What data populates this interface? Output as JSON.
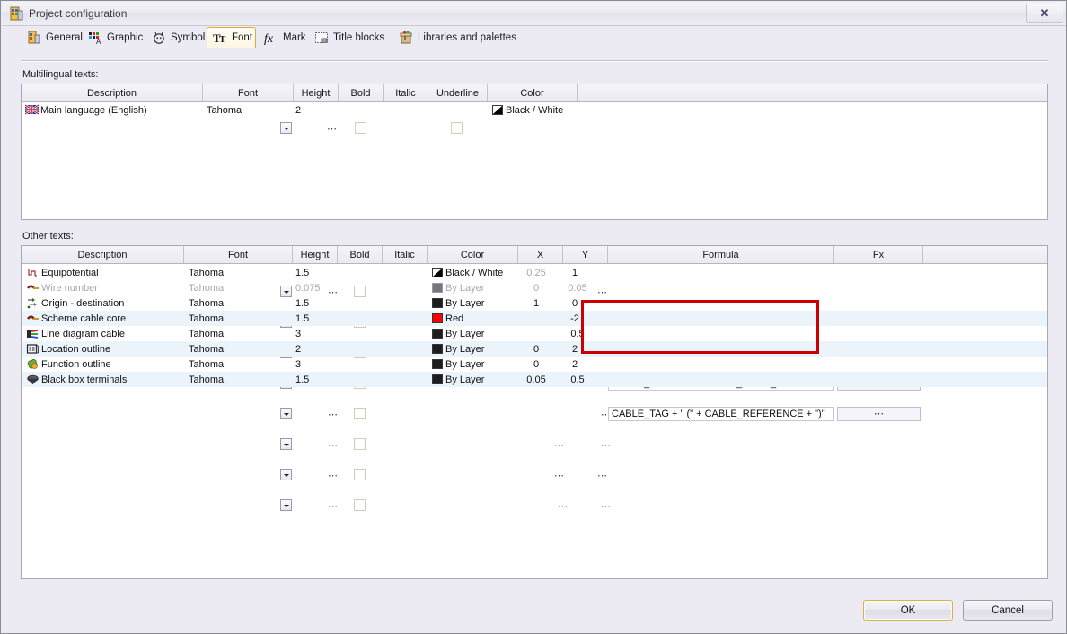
{
  "window": {
    "title": "Project configuration",
    "icon": "project-config-icon",
    "close_label": "✕"
  },
  "tabs": [
    {
      "label": "General",
      "icon": "general-icon",
      "selected": false
    },
    {
      "label": "Graphic",
      "icon": "graphic-icon",
      "selected": false
    },
    {
      "label": "Symbol",
      "icon": "symbol-icon",
      "selected": false
    },
    {
      "label": "Font",
      "icon": "font-icon",
      "selected": true
    },
    {
      "label": "Mark",
      "icon": "fx-icon",
      "selected": false
    },
    {
      "label": "Title blocks",
      "icon": "titleblock-icon",
      "selected": false
    },
    {
      "label": "Libraries and palettes",
      "icon": "library-icon",
      "selected": false
    }
  ],
  "multilingual": {
    "group_label": "Multilingual texts:",
    "columns": [
      "Description",
      "Font",
      "Height",
      "Bold",
      "Italic",
      "Underline",
      "Color",
      ""
    ],
    "rows": [
      {
        "icon": "flag-uk-icon",
        "description": "Main language (English)",
        "font": "Tahoma",
        "height": "2",
        "bold": false,
        "italic": false,
        "underline": false,
        "color_label": "Black / White",
        "color_swatch": "bw",
        "ellipsis": "⋯"
      }
    ]
  },
  "other_texts": {
    "group_label": "Other texts:",
    "columns": [
      "Description",
      "Font",
      "Height",
      "Bold",
      "Italic",
      "Color",
      "X",
      "Y",
      "Formula",
      "Fx",
      ""
    ],
    "rows": [
      {
        "icon": "equipotential-icon",
        "description": "Equipotential",
        "font": "Tahoma",
        "height": "1.5",
        "bold": false,
        "color_label": "Black / White",
        "color_swatch": "bw",
        "x": "0.25",
        "x_dim": true,
        "y": "1",
        "y_ell": false,
        "formula": "",
        "fx": "",
        "disabled": false,
        "alt": false
      },
      {
        "icon": "wire-number-icon",
        "description": "Wire number",
        "font": "Tahoma",
        "height": "0.075",
        "bold": false,
        "color_label": "By Layer",
        "color_swatch": "dim",
        "x": "0",
        "x_dim": true,
        "y": "0.05",
        "y_ell": true,
        "formula": "",
        "fx": "",
        "disabled": true,
        "alt": false
      },
      {
        "icon": "origin-destination-icon",
        "description": "Origin - destination",
        "font": "Tahoma",
        "height": "1.5",
        "bold": false,
        "color_label": "By Layer",
        "color_swatch": "black",
        "x": "1",
        "x_dim": false,
        "y": "0",
        "y_ell": true,
        "formula": "",
        "fx": "",
        "disabled": false,
        "alt": false
      },
      {
        "icon": "scheme-cable-core-icon",
        "description": "Scheme cable core",
        "font": "Tahoma",
        "height": "1.5",
        "bold": false,
        "color_label": "Red",
        "color_swatch": "red",
        "x": "",
        "x_dim": false,
        "y": "-2",
        "y_ell": false,
        "formula": "CABLE_TAG + \"\\\\\" + CABLE_CORE_DESCRIPTI...",
        "fx": "⋯",
        "disabled": false,
        "alt": true
      },
      {
        "icon": "line-diagram-cable-icon",
        "description": "Line diagram cable",
        "font": "Tahoma",
        "height": "3",
        "bold": false,
        "color_label": "By Layer",
        "color_swatch": "black",
        "x": "",
        "x_dim": false,
        "y": "0.5",
        "y_ell": false,
        "formula": "CABLE_TAG + \" (\" + CABLE_REFERENCE + \")\"",
        "fx": "⋯",
        "disabled": false,
        "alt": false
      },
      {
        "icon": "location-outline-icon",
        "description": "Location outline",
        "font": "Tahoma",
        "height": "2",
        "bold": false,
        "color_label": "By Layer",
        "color_swatch": "black",
        "x": "0",
        "x_dim": false,
        "y": "2",
        "y_ell": true,
        "formula": "",
        "fx": "",
        "disabled": false,
        "alt": true
      },
      {
        "icon": "function-outline-icon",
        "description": "Function outline",
        "font": "Tahoma",
        "height": "3",
        "bold": false,
        "color_label": "By Layer",
        "color_swatch": "black",
        "x": "0",
        "x_dim": false,
        "y": "2",
        "y_ell": true,
        "formula": "",
        "fx": "",
        "disabled": false,
        "alt": false
      },
      {
        "icon": "black-box-terminals-icon",
        "description": "Black box terminals",
        "font": "Tahoma",
        "height": "1.5",
        "bold": false,
        "color_label": "By Layer",
        "color_swatch": "black",
        "x": "0.05",
        "x_dim": false,
        "y": "0.5",
        "y_ell": true,
        "formula": "",
        "fx": "",
        "disabled": false,
        "alt": true
      }
    ]
  },
  "annotation": {
    "color": "#cc0000"
  },
  "footer": {
    "ok_label": "OK",
    "cancel_label": "Cancel"
  },
  "ellipsis_glyph": "⋯"
}
